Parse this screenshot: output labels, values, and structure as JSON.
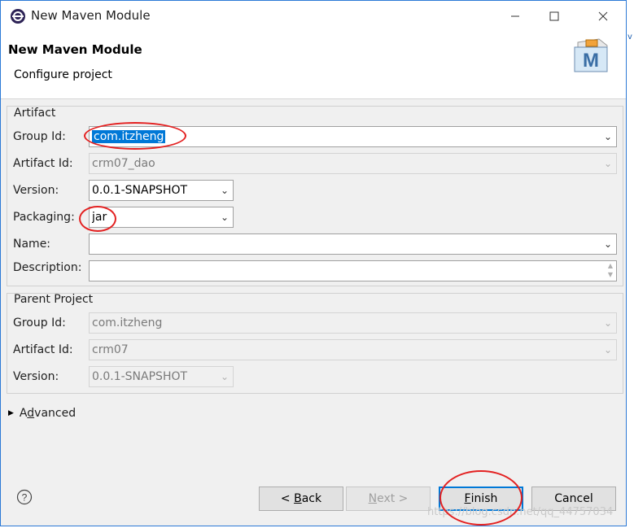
{
  "window": {
    "title": "New Maven Module"
  },
  "header": {
    "title": "New Maven Module",
    "subtitle": "Configure project",
    "logo_letter": "M"
  },
  "artifact": {
    "legend": "Artifact",
    "group_id": {
      "label": "Group Id:",
      "value": "com.itzheng"
    },
    "artifact_id": {
      "label": "Artifact Id:",
      "value": "crm07_dao"
    },
    "version": {
      "label": "Version:",
      "value": "0.0.1-SNAPSHOT"
    },
    "packaging": {
      "label": "Packaging:",
      "value": "jar"
    },
    "name": {
      "label": "Name:",
      "value": ""
    },
    "description": {
      "label": "Description:",
      "value": ""
    }
  },
  "parent": {
    "legend": "Parent Project",
    "group_id": {
      "label": "Group Id:",
      "value": "com.itzheng"
    },
    "artifact_id": {
      "label": "Artifact Id:",
      "value": "crm07"
    },
    "version": {
      "label": "Version:",
      "value": "0.0.1-SNAPSHOT"
    }
  },
  "advanced": {
    "label_prefix": "A",
    "label_mnemonic": "d",
    "label_rest": "vanced"
  },
  "buttons": {
    "back": {
      "prefix": "< ",
      "mnemonic": "B",
      "rest": "ack"
    },
    "next": {
      "mnemonic": "N",
      "rest": "ext >"
    },
    "finish": {
      "mnemonic": "F",
      "rest": "inish"
    },
    "cancel": "Cancel"
  },
  "watermark": "https://blog.csdn.net/qq_44757034",
  "colors": {
    "selection": "#0078d7",
    "annotation": "#e32121",
    "frame": "#2b79d6"
  }
}
